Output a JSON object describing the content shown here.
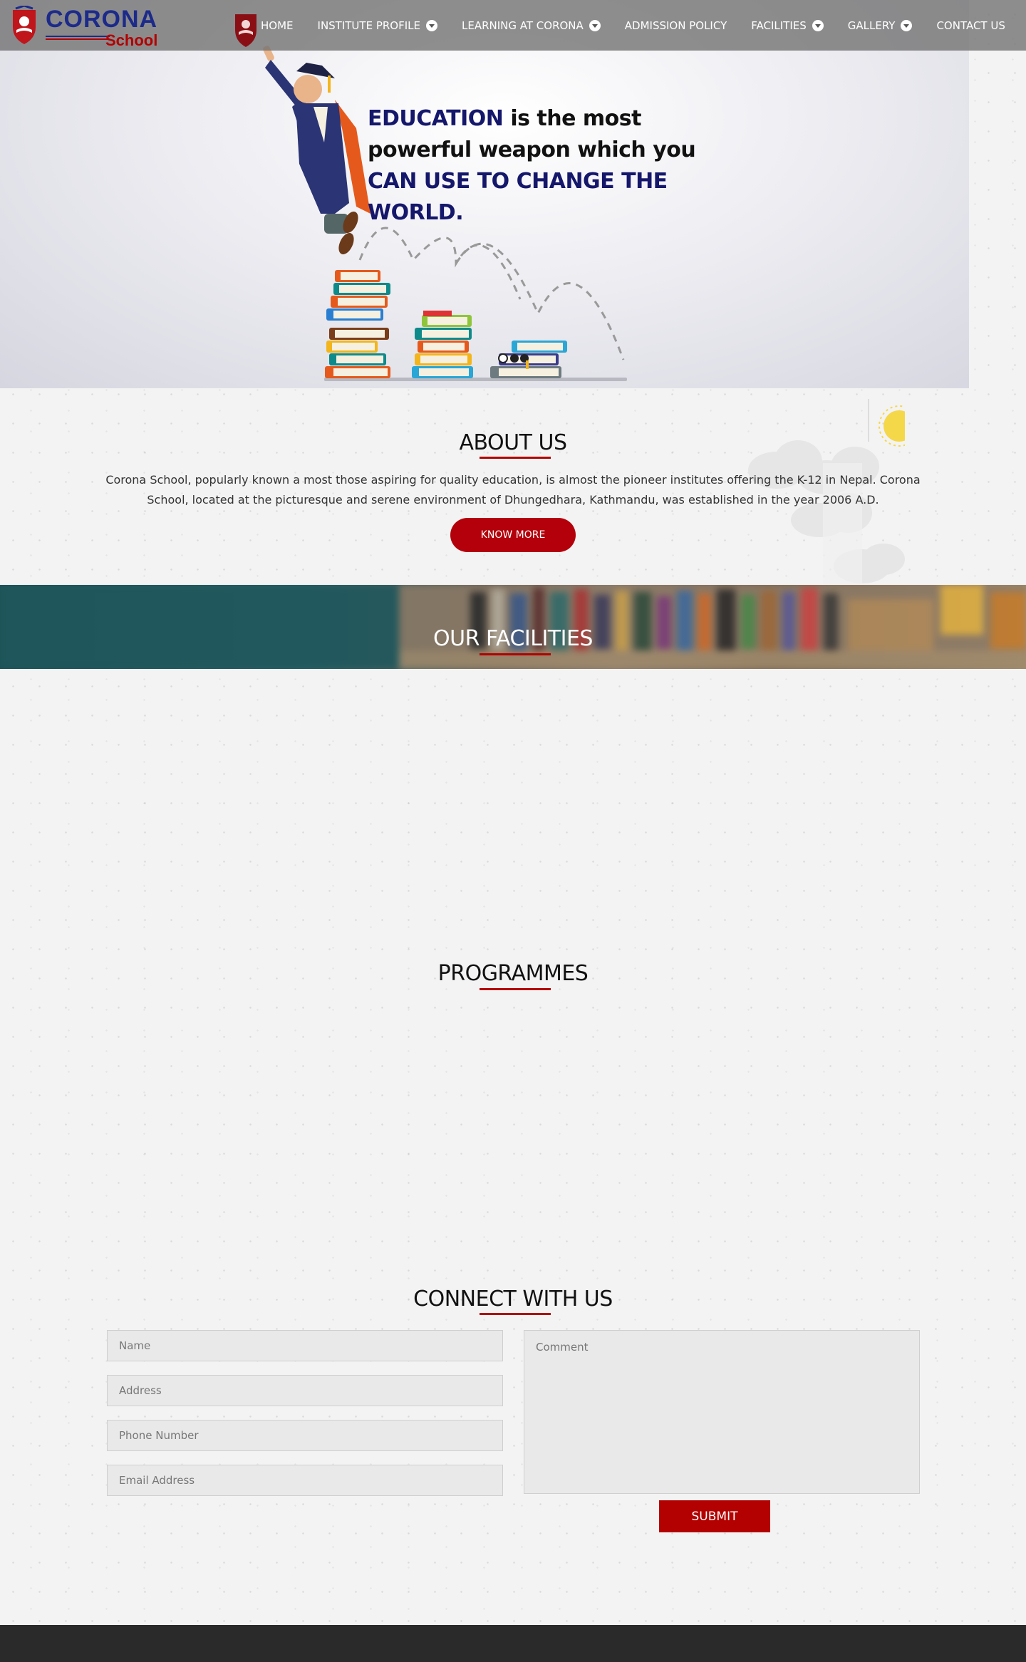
{
  "brand": {
    "name_line1": "CORONA",
    "name_line2": "School",
    "colors": {
      "blue": "#1c2a8a",
      "red": "#b30000"
    }
  },
  "nav": {
    "items": [
      {
        "label": "HOME",
        "dropdown": false
      },
      {
        "label": "INSTITUTE PROFILE",
        "dropdown": true
      },
      {
        "label": "LEARNING AT CORONA",
        "dropdown": true
      },
      {
        "label": "ADMISSION POLICY",
        "dropdown": false
      },
      {
        "label": "FACILITIES",
        "dropdown": true
      },
      {
        "label": "GALLERY",
        "dropdown": true
      },
      {
        "label": "CONTACT US",
        "dropdown": false
      }
    ]
  },
  "hero": {
    "quote_highlight_1": "EDUCATION",
    "quote_mid_1": " is the most",
    "quote_mid_2": "powerful weapon which you",
    "quote_highlight_2": "CAN USE TO CHANGE THE WORLD."
  },
  "about": {
    "title": "ABOUT US",
    "text": "Corona School, popularly known a most those aspiring for quality education, is almost the pioneer institutes offering the K-12 in Nepal. Corona School, located at the picturesque and serene environment of Dhungedhara, Kathmandu, was established in the year 2006 A.D.",
    "button": "KNOW MORE"
  },
  "facilities": {
    "title": "OUR FACILITIES"
  },
  "programmes": {
    "title": "PROGRAMMES"
  },
  "connect": {
    "title": "CONNECT WITH US",
    "fields": {
      "name": "Name",
      "address": "Address",
      "phone": "Phone Number",
      "email": "Email Address",
      "comment": "Comment"
    },
    "submit": "SUBMIT"
  },
  "icons": {
    "logo": "school-emblem-icon",
    "dropdown": "chevron-down-icon"
  }
}
